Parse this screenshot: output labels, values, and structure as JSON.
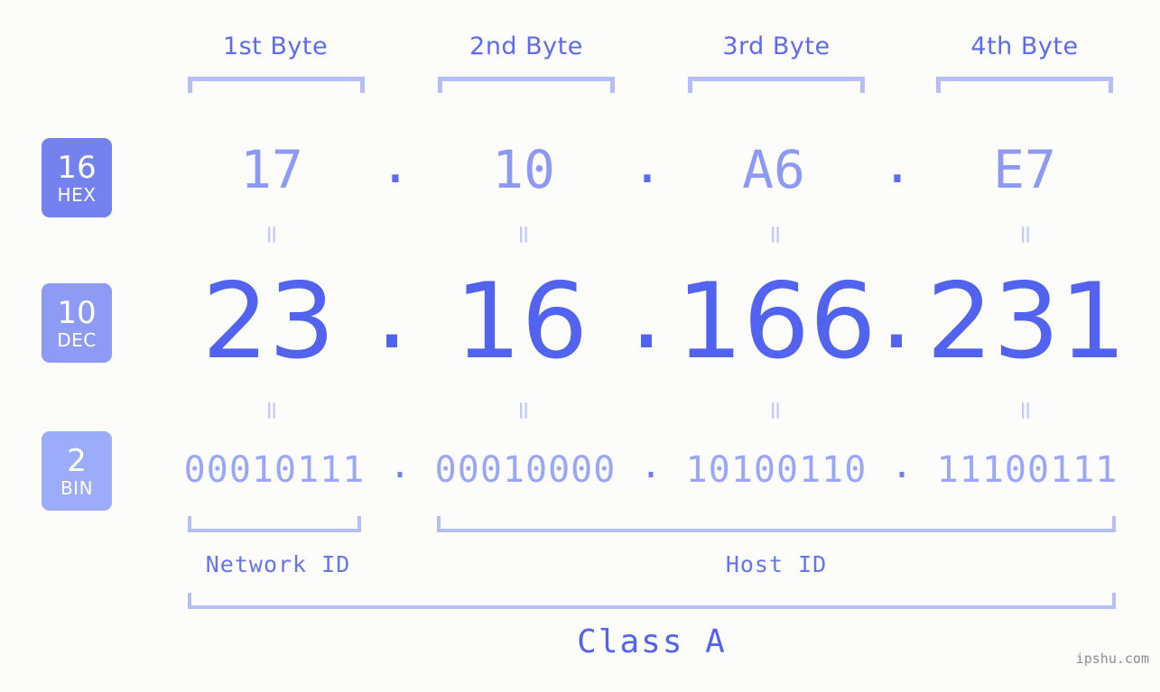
{
  "background_color": "#fcfdfa",
  "accent_colors": {
    "strong": "#5163ef",
    "medium": "#8c99f6",
    "light": "#b6bdfb",
    "badge_hex": "#7382ef",
    "badge_dec": "#8e9bf5",
    "badge_bin": "#9bacfa",
    "watermark": "#8d8d8d"
  },
  "byte_headers": [
    {
      "label": "1st Byte"
    },
    {
      "label": "2nd Byte"
    },
    {
      "label": "3rd Byte"
    },
    {
      "label": "4th Byte"
    }
  ],
  "bases": [
    {
      "number": "16",
      "name": "HEX"
    },
    {
      "number": "10",
      "name": "DEC"
    },
    {
      "number": "2",
      "name": "BIN"
    }
  ],
  "rows": {
    "hex": {
      "base": "16",
      "base_name": "HEX",
      "octets": [
        "17",
        "10",
        "A6",
        "E7"
      ],
      "separator": "."
    },
    "dec": {
      "base": "10",
      "base_name": "DEC",
      "octets": [
        "23",
        "16",
        "166",
        "231"
      ],
      "separator": "."
    },
    "bin": {
      "base": "2",
      "base_name": "BIN",
      "octets": [
        "00010111",
        "00010000",
        "10100110",
        "11100111"
      ],
      "separator": "."
    }
  },
  "equals_marks": {
    "glyph": "=",
    "count_per_row": 4,
    "rows": 2
  },
  "sections": {
    "network_id": "Network ID",
    "host_id": "Host ID",
    "class": "Class A"
  },
  "watermark": "ipshu.com"
}
